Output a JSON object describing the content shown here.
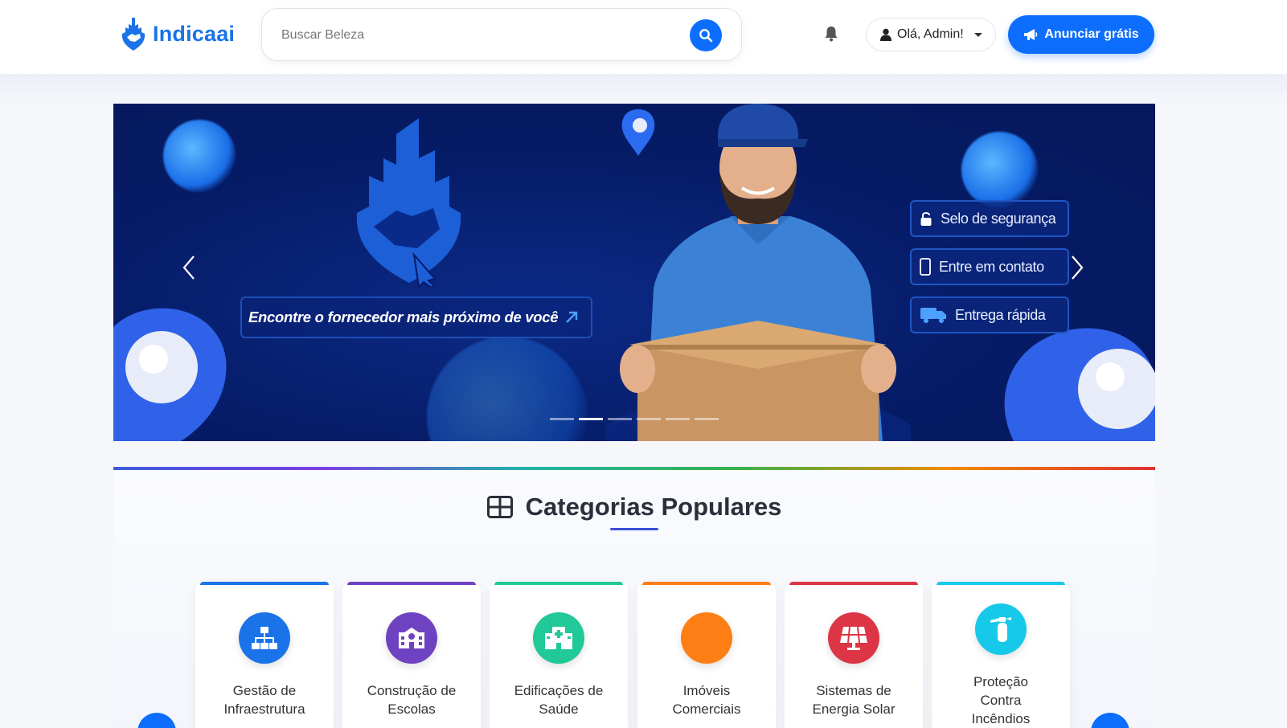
{
  "header": {
    "brand": "Indicaai",
    "search_placeholder": "Buscar Beleza",
    "user_greeting": "Olá, Admin!",
    "cta_label": "Anunciar grátis"
  },
  "banner": {
    "tagline": "Encontre o fornecedor mais próximo de você",
    "badges": [
      "Selo de segurança",
      "Entre em contato",
      "Entrega rápida"
    ],
    "active_slide": 2,
    "slide_count": 6
  },
  "categories": {
    "title": "Categorias Populares",
    "items": [
      {
        "label": "Gestão de Infraestrutura",
        "line1": "Gestão de",
        "line2": "Infraestrutura",
        "color": "#1a73e8",
        "icon": "sitemap-icon"
      },
      {
        "label": "Construção de Escolas",
        "line1": "Construção de",
        "line2": "Escolas",
        "color": "#6f42c1",
        "icon": "school-icon"
      },
      {
        "label": "Edificações de Saúde",
        "line1": "Edificações de",
        "line2": "Saúde",
        "color": "#20c997",
        "icon": "hospital-icon"
      },
      {
        "label": "Imóveis Comerciais",
        "line1": "Imóveis",
        "line2": "Comerciais",
        "color": "#fd7e14",
        "icon": "building-icon"
      },
      {
        "label": "Sistemas de Energia Solar",
        "line1": "Sistemas de",
        "line2": "Energia Solar",
        "color": "#dc3545",
        "icon": "solar-panel-icon"
      },
      {
        "label": "Proteção Contra Incêndios",
        "line1": "Proteção",
        "line2": "Contra",
        "line3": "Incêndios",
        "color": "#17c9e8",
        "icon": "fire-extinguisher-icon"
      }
    ]
  },
  "colors": {
    "primary": "#0d6efd",
    "brand_text": "#1a73e8",
    "banner_bg": "#061b66"
  }
}
